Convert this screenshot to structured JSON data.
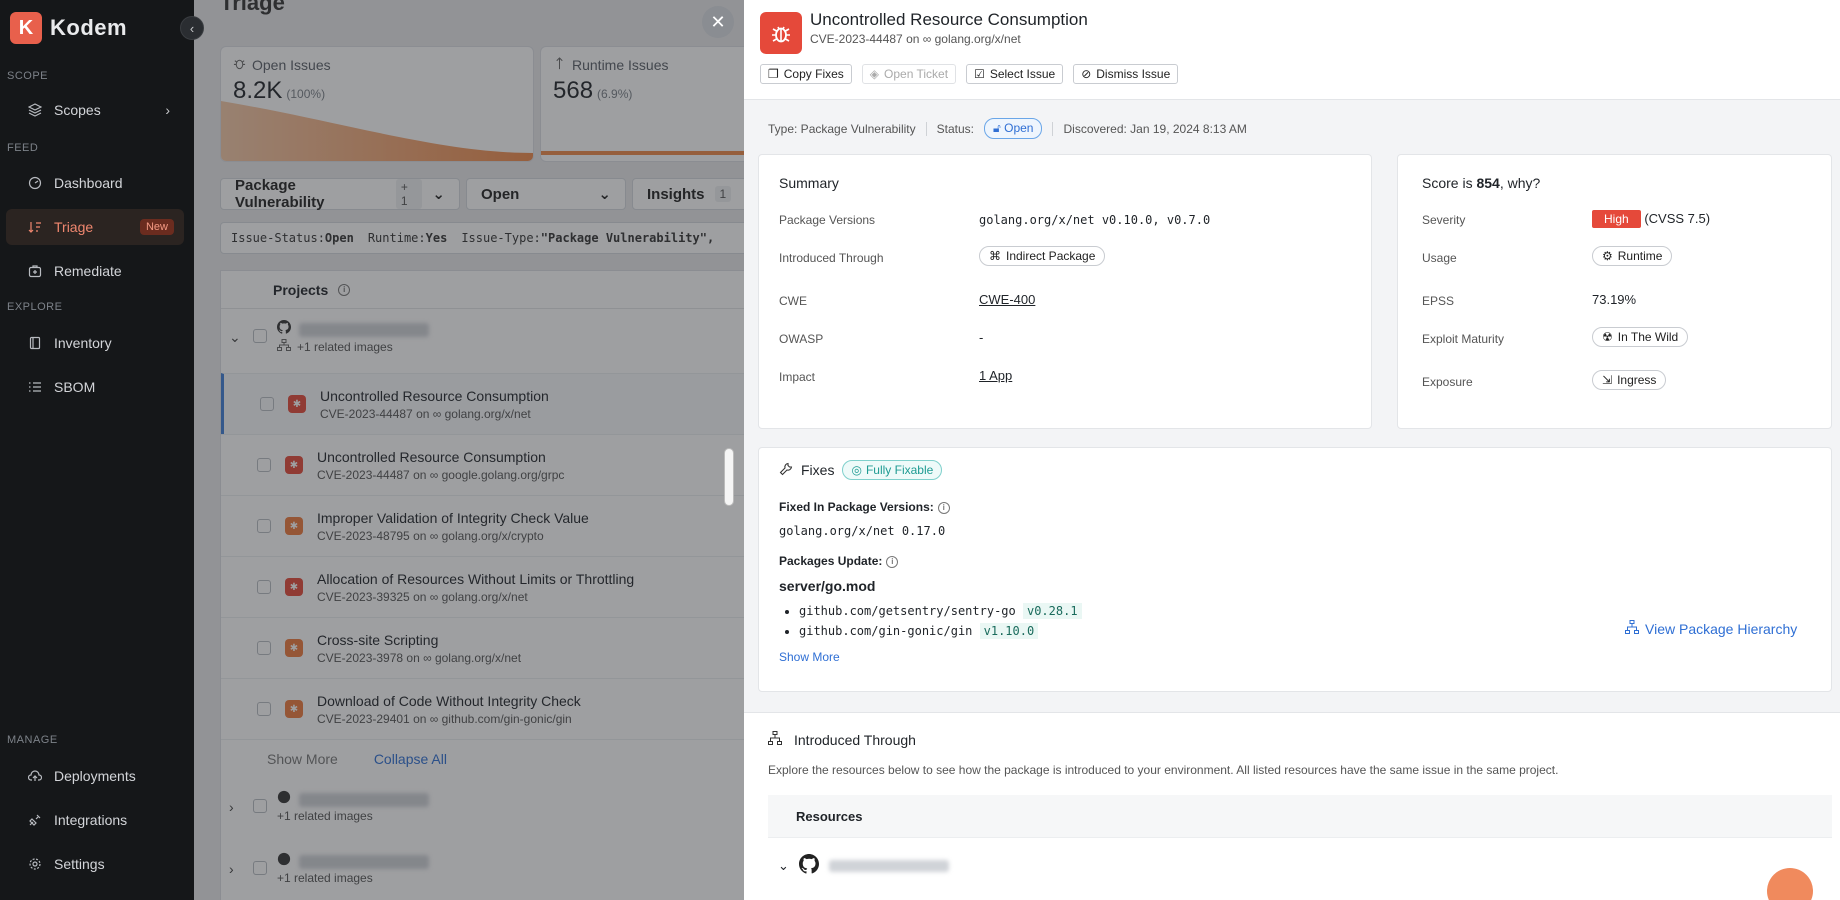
{
  "app": {
    "logo_letter": "K",
    "name": "Kodem"
  },
  "sidebar": {
    "sections": {
      "scope": "SCOPE",
      "feed": "FEED",
      "explore": "EXPLORE",
      "manage": "MANAGE"
    },
    "items": {
      "scopes": "Scopes",
      "dashboard": "Dashboard",
      "triage": "Triage",
      "triage_badge": "New",
      "remediate": "Remediate",
      "inventory": "Inventory",
      "sbom": "SBOM",
      "deployments": "Deployments",
      "integrations": "Integrations",
      "settings": "Settings"
    }
  },
  "main": {
    "title": "Triage",
    "stats": [
      {
        "label": "Open Issues",
        "value": "8.2K",
        "pct": "(100%)"
      },
      {
        "label": "Runtime Issues",
        "value": "568",
        "pct": "(6.9%)"
      }
    ],
    "filters": {
      "type": "Package Vulnerability",
      "type_count": "+ 1",
      "status": "Open",
      "insights": "Insights",
      "insights_count": "1"
    },
    "chips": [
      {
        "key": "Issue-Status:",
        "val": "Open"
      },
      {
        "key": "Runtime:",
        "val": "Yes"
      },
      {
        "key": "Issue-Type:",
        "val": "\"Package Vulnerability\","
      }
    ],
    "table_header": "Projects",
    "project_related": "+1 related images",
    "issues": [
      {
        "title": "Uncontrolled Resource Consumption",
        "sub": "CVE-2023-44487 on ∞ golang.org/x/net",
        "sev": "red"
      },
      {
        "title": "Uncontrolled Resource Consumption",
        "sub": "CVE-2023-44487 on ∞ google.golang.org/grpc",
        "sev": "red"
      },
      {
        "title": "Improper Validation of Integrity Check Value",
        "sub": "CVE-2023-48795 on ∞ golang.org/x/crypto",
        "sev": "orange"
      },
      {
        "title": "Allocation of Resources Without Limits or Throttling",
        "sub": "CVE-2023-39325 on ∞ golang.org/x/net",
        "sev": "red"
      },
      {
        "title": "Cross-site Scripting",
        "sub": "CVE-2023-3978 on ∞ golang.org/x/net",
        "sev": "orange"
      },
      {
        "title": "Download of Code Without Integrity Check",
        "sub": "CVE-2023-29401 on ∞ github.com/gin-gonic/gin",
        "sev": "orange"
      }
    ],
    "show_more": "Show More",
    "collapse_all": "Collapse All"
  },
  "drawer": {
    "title": "Uncontrolled Resource Consumption",
    "subtitle": "CVE-2023-44487 on ∞ golang.org/x/net",
    "actions": {
      "copy_fixes": "Copy Fixes",
      "open_ticket": "Open Ticket",
      "select_issue": "Select Issue",
      "dismiss_issue": "Dismiss Issue"
    },
    "meta": {
      "type": "Type: Package Vulnerability",
      "status_label": "Status:",
      "status": "Open",
      "discovered": "Discovered: Jan 19, 2024 8:13 AM"
    },
    "summary": {
      "heading": "Summary",
      "package_versions_label": "Package Versions",
      "package_versions": "golang.org/x/net v0.10.0, v0.7.0",
      "introduced_label": "Introduced Through",
      "introduced": "Indirect Package",
      "cwe_label": "CWE",
      "cwe": "CWE-400",
      "owasp_label": "OWASP",
      "owasp": "-",
      "impact_label": "Impact",
      "impact": "1 App"
    },
    "score": {
      "heading_pre": "Score is ",
      "score": "854",
      "heading_post": ", why?",
      "severity_label": "Severity",
      "severity": "High",
      "cvss": "(CVSS 7.5)",
      "usage_label": "Usage",
      "usage": "Runtime",
      "epss_label": "EPSS",
      "epss": "73.19%",
      "exploit_label": "Exploit Maturity",
      "exploit": "In The Wild",
      "exposure_label": "Exposure",
      "exposure": "Ingress"
    },
    "fixes": {
      "heading": "Fixes",
      "pill": "Fully Fixable",
      "fixed_in_label": "Fixed In Package Versions:",
      "fixed_in": "golang.org/x/net 0.17.0",
      "packages_update_label": "Packages Update:",
      "file": "server/go.mod",
      "packages": [
        {
          "name": "github.com/getsentry/sentry-go",
          "version": "v0.28.1"
        },
        {
          "name": "github.com/gin-gonic/gin",
          "version": "v1.10.0"
        }
      ],
      "show_more": "Show More",
      "view_hierarchy": "View Package Hierarchy"
    },
    "introduced_through": {
      "heading": "Introduced Through",
      "desc": "Explore the resources below to see how the package is introduced to your environment. All listed resources have the same issue in the same project.",
      "resources_header": "Resources"
    }
  }
}
